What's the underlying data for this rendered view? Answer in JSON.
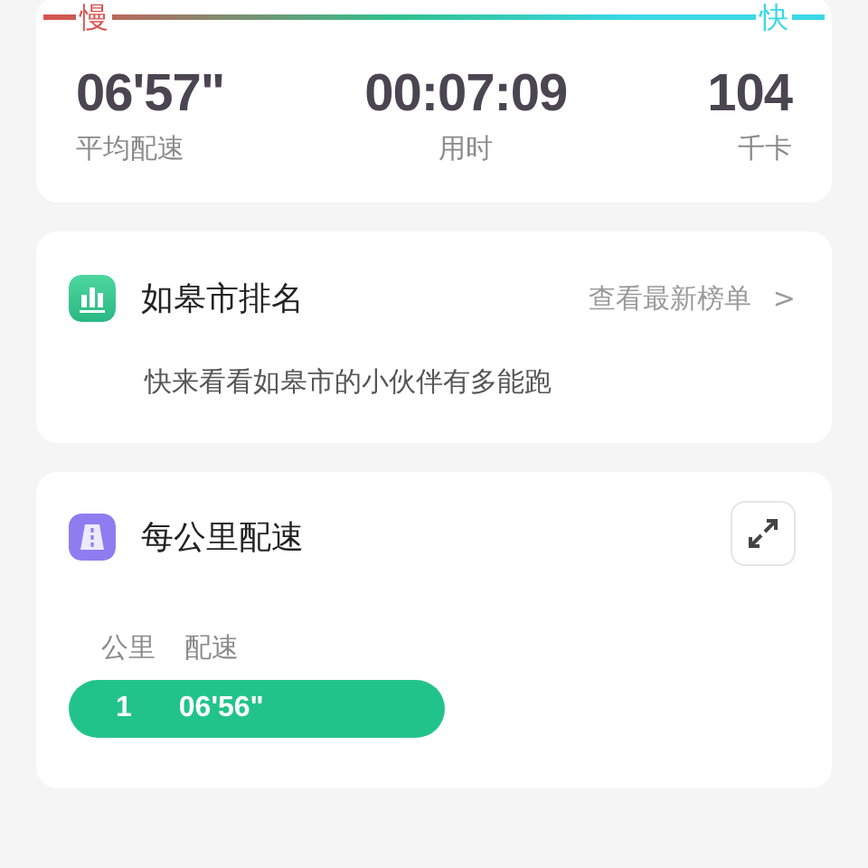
{
  "pace_scale": {
    "slow_label": "慢",
    "fast_label": "快"
  },
  "summary": [
    {
      "value": "06'57\"",
      "label": "平均配速"
    },
    {
      "value": "00:07:09",
      "label": "用时"
    },
    {
      "value": "104",
      "label": "千卡"
    }
  ],
  "ranking_card": {
    "title": "如皋市排名",
    "link": "查看最新榜单",
    "chevron": ">",
    "description": "快来看看如皋市的小伙伴有多能跑"
  },
  "pace_card": {
    "title": "每公里配速",
    "columns": [
      "公里",
      "配速"
    ],
    "rows": [
      {
        "km": "1",
        "pace": "06'56\""
      }
    ]
  }
}
